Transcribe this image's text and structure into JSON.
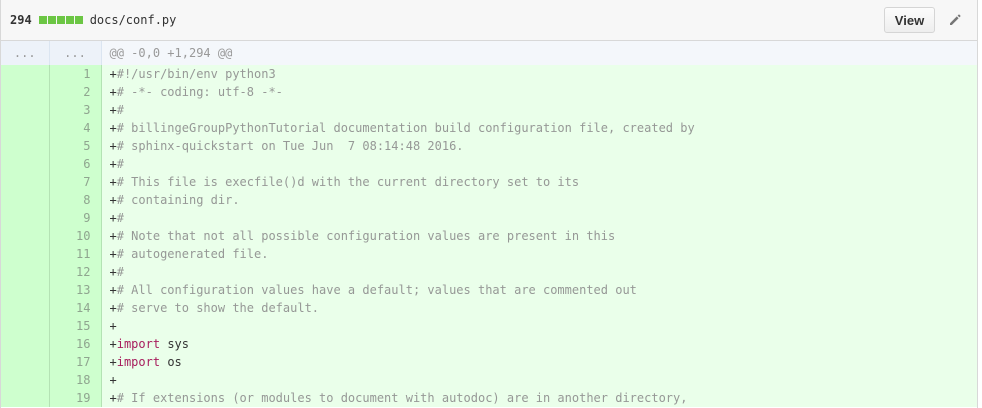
{
  "file_header": {
    "change_count": "294",
    "path": "docs/conf.py",
    "view_label": "View",
    "accent_color": "#6cc644"
  },
  "hunk": {
    "old_marker": "...",
    "new_marker": "...",
    "header": "@@ -0,0 +1,294 @@"
  },
  "lines": [
    {
      "num": "1",
      "sign": "+",
      "kw": "",
      "text": "#!/usr/bin/env python3"
    },
    {
      "num": "2",
      "sign": "+",
      "kw": "",
      "text": "# -*- coding: utf-8 -*-"
    },
    {
      "num": "3",
      "sign": "+",
      "kw": "",
      "text": "#"
    },
    {
      "num": "4",
      "sign": "+",
      "kw": "",
      "text": "# billingeGroupPythonTutorial documentation build configuration file, created by"
    },
    {
      "num": "5",
      "sign": "+",
      "kw": "",
      "text": "# sphinx-quickstart on Tue Jun  7 08:14:48 2016."
    },
    {
      "num": "6",
      "sign": "+",
      "kw": "",
      "text": "#"
    },
    {
      "num": "7",
      "sign": "+",
      "kw": "",
      "text": "# This file is execfile()d with the current directory set to its"
    },
    {
      "num": "8",
      "sign": "+",
      "kw": "",
      "text": "# containing dir."
    },
    {
      "num": "9",
      "sign": "+",
      "kw": "",
      "text": "#"
    },
    {
      "num": "10",
      "sign": "+",
      "kw": "",
      "text": "# Note that not all possible configuration values are present in this"
    },
    {
      "num": "11",
      "sign": "+",
      "kw": "",
      "text": "# autogenerated file."
    },
    {
      "num": "12",
      "sign": "+",
      "kw": "",
      "text": "#"
    },
    {
      "num": "13",
      "sign": "+",
      "kw": "",
      "text": "# All configuration values have a default; values that are commented out"
    },
    {
      "num": "14",
      "sign": "+",
      "kw": "",
      "text": "# serve to show the default."
    },
    {
      "num": "15",
      "sign": "+",
      "kw": "",
      "text": ""
    },
    {
      "num": "16",
      "sign": "+",
      "kw": "import",
      "text": " sys"
    },
    {
      "num": "17",
      "sign": "+",
      "kw": "import",
      "text": " os"
    },
    {
      "num": "18",
      "sign": "+",
      "kw": "",
      "text": ""
    },
    {
      "num": "19",
      "sign": "+",
      "kw": "",
      "text": "# If extensions (or modules to document with autodoc) are in another directory,"
    }
  ]
}
